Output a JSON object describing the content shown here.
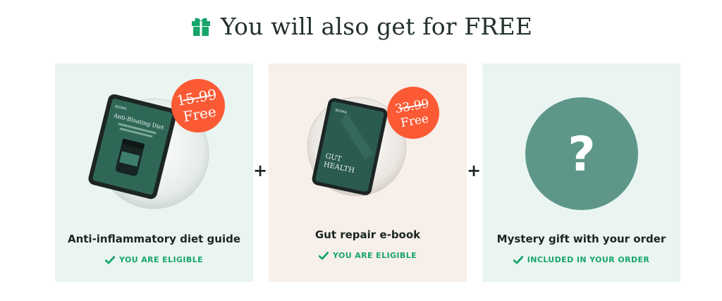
{
  "header": {
    "title": "You will also get for FREE",
    "icon": "gift-icon"
  },
  "offers": [
    {
      "title": "Anti-inflammatory diet guide",
      "status": "YOU ARE ELIGIBLE",
      "old_price": "15.99",
      "free_label": "Free",
      "cover_brand": "BIOMA",
      "cover_title": "Anti-Bloating Diet"
    },
    {
      "title": "Gut repair e-book",
      "status": "YOU ARE ELIGIBLE",
      "old_price": "33.99",
      "free_label": "Free",
      "cover_brand": "BIOMA",
      "cover_title_line1": "GUT",
      "cover_title_line2": "HEALTH"
    },
    {
      "title": "Mystery gift with your order",
      "status": "INCLUDED IN YOUR ORDER",
      "mystery_symbol": "?"
    }
  ],
  "separator": "+",
  "colors": {
    "accent_green": "#17a56b",
    "badge_orange": "#fb5a34",
    "card_mint": "#eaf5f1",
    "card_peach": "#f7efe9",
    "mystery_circle": "#5e978a"
  }
}
